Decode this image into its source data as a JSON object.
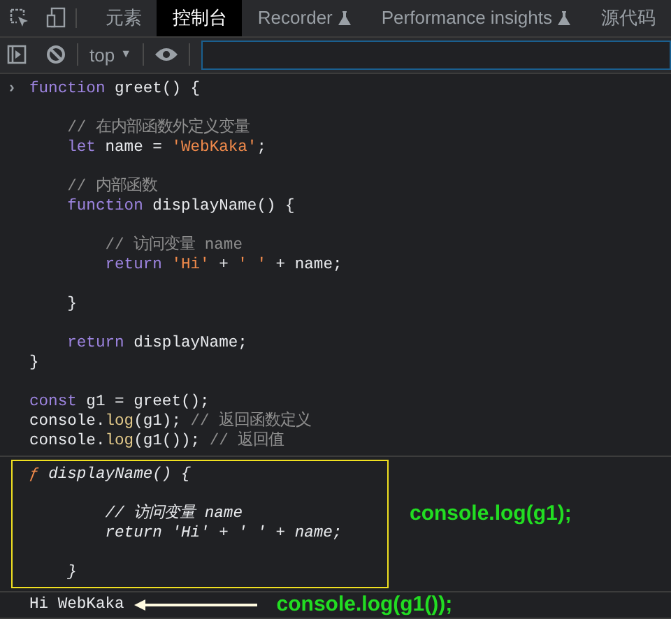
{
  "tabs": [
    {
      "label": "元素",
      "selected": false,
      "experimental": false
    },
    {
      "label": "控制台",
      "selected": true,
      "experimental": false
    },
    {
      "label": "Recorder",
      "selected": false,
      "experimental": true
    },
    {
      "label": "Performance insights",
      "selected": false,
      "experimental": true
    },
    {
      "label": "源代码",
      "selected": false,
      "experimental": false
    }
  ],
  "context_select": {
    "value": "top",
    "arrow": "▼"
  },
  "prompt": "›",
  "input_lines": [
    {
      "kind": "code",
      "tokens": [
        {
          "text": "function",
          "kind": "keyword"
        },
        {
          "text": " greet() {",
          "kind": "plain"
        }
      ]
    },
    {
      "kind": "blank"
    },
    {
      "kind": "code",
      "tokens": [
        {
          "text": "    // 在内部函数外定义变量",
          "kind": "comment"
        }
      ]
    },
    {
      "kind": "code",
      "tokens": [
        {
          "text": "    let",
          "kind": "keyword"
        },
        {
          "text": " name = ",
          "kind": "plain"
        },
        {
          "text": "'WebKaka'",
          "kind": "string"
        },
        {
          "text": ";",
          "kind": "plain"
        }
      ]
    },
    {
      "kind": "blank"
    },
    {
      "kind": "code",
      "tokens": [
        {
          "text": "    // 内部函数",
          "kind": "comment"
        }
      ]
    },
    {
      "kind": "code",
      "tokens": [
        {
          "text": "    function",
          "kind": "keyword"
        },
        {
          "text": " displayName() {",
          "kind": "plain"
        }
      ]
    },
    {
      "kind": "blank"
    },
    {
      "kind": "code",
      "tokens": [
        {
          "text": "        // 访问变量 name",
          "kind": "comment"
        }
      ]
    },
    {
      "kind": "code",
      "tokens": [
        {
          "text": "        return",
          "kind": "keyword"
        },
        {
          "text": " 'Hi'",
          "kind": "string"
        },
        {
          "text": " + ",
          "kind": "plain"
        },
        {
          "text": "' '",
          "kind": "string"
        },
        {
          "text": " + name;",
          "kind": "plain"
        }
      ]
    },
    {
      "kind": "blank"
    },
    {
      "kind": "code",
      "tokens": [
        {
          "text": "    }",
          "kind": "plain"
        }
      ]
    },
    {
      "kind": "blank"
    },
    {
      "kind": "code",
      "tokens": [
        {
          "text": "    return",
          "kind": "keyword"
        },
        {
          "text": " displayName;",
          "kind": "plain"
        }
      ]
    },
    {
      "kind": "code",
      "tokens": [
        {
          "text": "}",
          "kind": "plain"
        }
      ]
    },
    {
      "kind": "blank"
    },
    {
      "kind": "code",
      "tokens": [
        {
          "text": "const",
          "kind": "keyword"
        },
        {
          "text": " g1 = greet();",
          "kind": "plain"
        }
      ]
    },
    {
      "kind": "code",
      "tokens": [
        {
          "text": "console.",
          "kind": "plain"
        },
        {
          "text": "log",
          "kind": "method"
        },
        {
          "text": "(g1); ",
          "kind": "plain"
        },
        {
          "text": "// 返回函数定义",
          "kind": "comment"
        }
      ]
    },
    {
      "kind": "code",
      "tokens": [
        {
          "text": "console.",
          "kind": "plain"
        },
        {
          "text": "log",
          "kind": "method"
        },
        {
          "text": "(g1()); ",
          "kind": "plain"
        },
        {
          "text": "// 返回值",
          "kind": "comment"
        }
      ]
    }
  ],
  "output_function": {
    "prefix": "ƒ",
    "lines": [
      {
        "kind": "code",
        "text": "displayName() {"
      },
      {
        "kind": "blank"
      },
      {
        "kind": "code",
        "text": "        // 访问变量 name"
      },
      {
        "kind": "code",
        "text": "        return 'Hi' + ' ' + name;"
      },
      {
        "kind": "blank"
      },
      {
        "kind": "code",
        "text": "    }"
      }
    ]
  },
  "output_function_note": "console.log(g1);",
  "output_value": "Hi WebKaka",
  "output_value_note": "console.log(g1());"
}
